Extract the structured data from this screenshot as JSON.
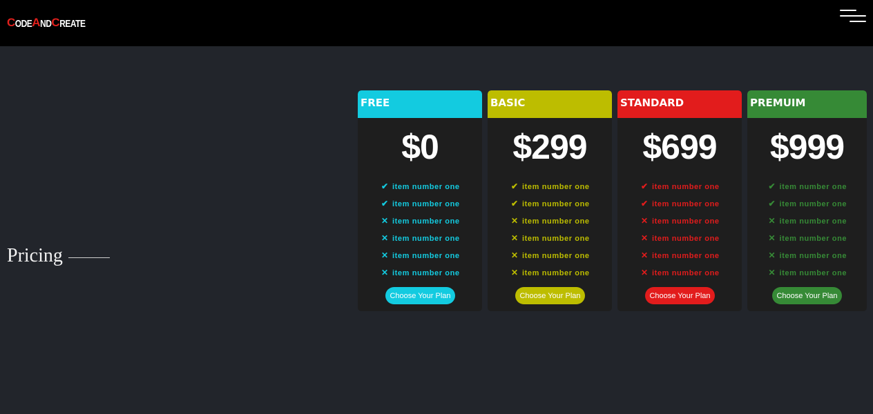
{
  "brand": {
    "parts": [
      "C",
      "ODE",
      "A",
      "ND",
      "C",
      "REATE"
    ],
    "accent": "#e0201c"
  },
  "section": {
    "title": "Pricing"
  },
  "plans": [
    {
      "name": "FREE",
      "price": "$0",
      "color": "#13cbe0",
      "features": [
        {
          "included": true,
          "mark": "✔",
          "text": "item number one"
        },
        {
          "included": true,
          "mark": "✔",
          "text": "item number one"
        },
        {
          "included": false,
          "mark": "✕",
          "text": "item number one"
        },
        {
          "included": false,
          "mark": "✕",
          "text": "item number one"
        },
        {
          "included": false,
          "mark": "✕",
          "text": "item number one"
        },
        {
          "included": false,
          "mark": "✕",
          "text": "item number one"
        }
      ],
      "button": "Choose Your Plan"
    },
    {
      "name": "BASIC",
      "price": "$299",
      "color": "#bdbd00",
      "features": [
        {
          "included": true,
          "mark": "✔",
          "text": "item number one"
        },
        {
          "included": true,
          "mark": "✔",
          "text": "item number one"
        },
        {
          "included": false,
          "mark": "✕",
          "text": "item number one"
        },
        {
          "included": false,
          "mark": "✕",
          "text": "item number one"
        },
        {
          "included": false,
          "mark": "✕",
          "text": "item number one"
        },
        {
          "included": false,
          "mark": "✕",
          "text": "item number one"
        }
      ],
      "button": "Choose Your Plan"
    },
    {
      "name": "STANDARD",
      "price": "$699",
      "color": "#e21c1c",
      "features": [
        {
          "included": true,
          "mark": "✔",
          "text": "item number one"
        },
        {
          "included": true,
          "mark": "✔",
          "text": "item number one"
        },
        {
          "included": false,
          "mark": "✕",
          "text": "item number one"
        },
        {
          "included": false,
          "mark": "✕",
          "text": "item number one"
        },
        {
          "included": false,
          "mark": "✕",
          "text": "item number one"
        },
        {
          "included": false,
          "mark": "✕",
          "text": "item number one"
        }
      ],
      "button": "Choose Your Plan"
    },
    {
      "name": "PREMUIM",
      "price": "$999",
      "color": "#368a36",
      "features": [
        {
          "included": true,
          "mark": "✔",
          "text": "item number one"
        },
        {
          "included": true,
          "mark": "✔",
          "text": "item number one"
        },
        {
          "included": false,
          "mark": "✕",
          "text": "item number one"
        },
        {
          "included": false,
          "mark": "✕",
          "text": "item number one"
        },
        {
          "included": false,
          "mark": "✕",
          "text": "item number one"
        },
        {
          "included": false,
          "mark": "✕",
          "text": "item number one"
        }
      ],
      "button": "Choose Your Plan"
    }
  ],
  "icons": {
    "menu": "hamburger-menu-icon",
    "included": "check-icon",
    "excluded": "cross-icon"
  }
}
